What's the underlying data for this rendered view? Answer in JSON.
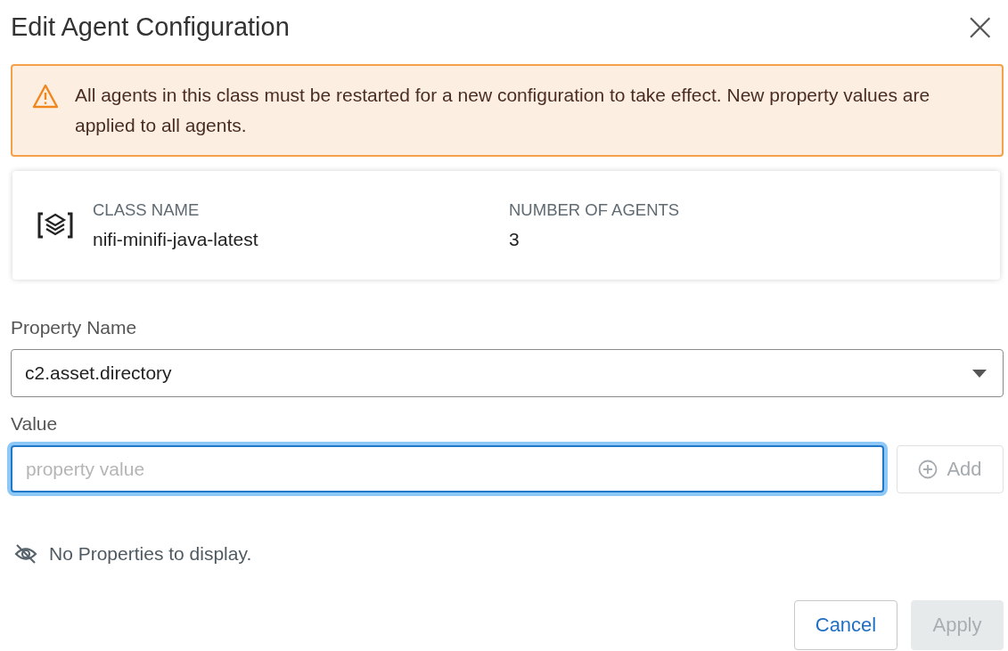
{
  "dialog": {
    "title": "Edit Agent Configuration",
    "close": "×"
  },
  "alert": {
    "text": "All agents in this class must be restarted for a new configuration to take effect. New property values are applied to all agents."
  },
  "summary": [
    {
      "label": "CLASS NAME",
      "value": "nifi-minifi-java-latest"
    },
    {
      "label": "NUMBER OF AGENTS",
      "value": "3"
    }
  ],
  "property": {
    "label": "Property Name",
    "value": "c2.asset.directory"
  },
  "value_field": {
    "label": "Value",
    "placeholder": "property value",
    "focused": true
  },
  "add_button": {
    "label": "Add",
    "disabled": true
  },
  "empty_message": "No Properties to display.",
  "buttons": [
    {
      "label": "Cancel",
      "kind": "secondary",
      "disabled": false
    },
    {
      "label": "Apply",
      "kind": "primary",
      "disabled": true
    }
  ]
}
